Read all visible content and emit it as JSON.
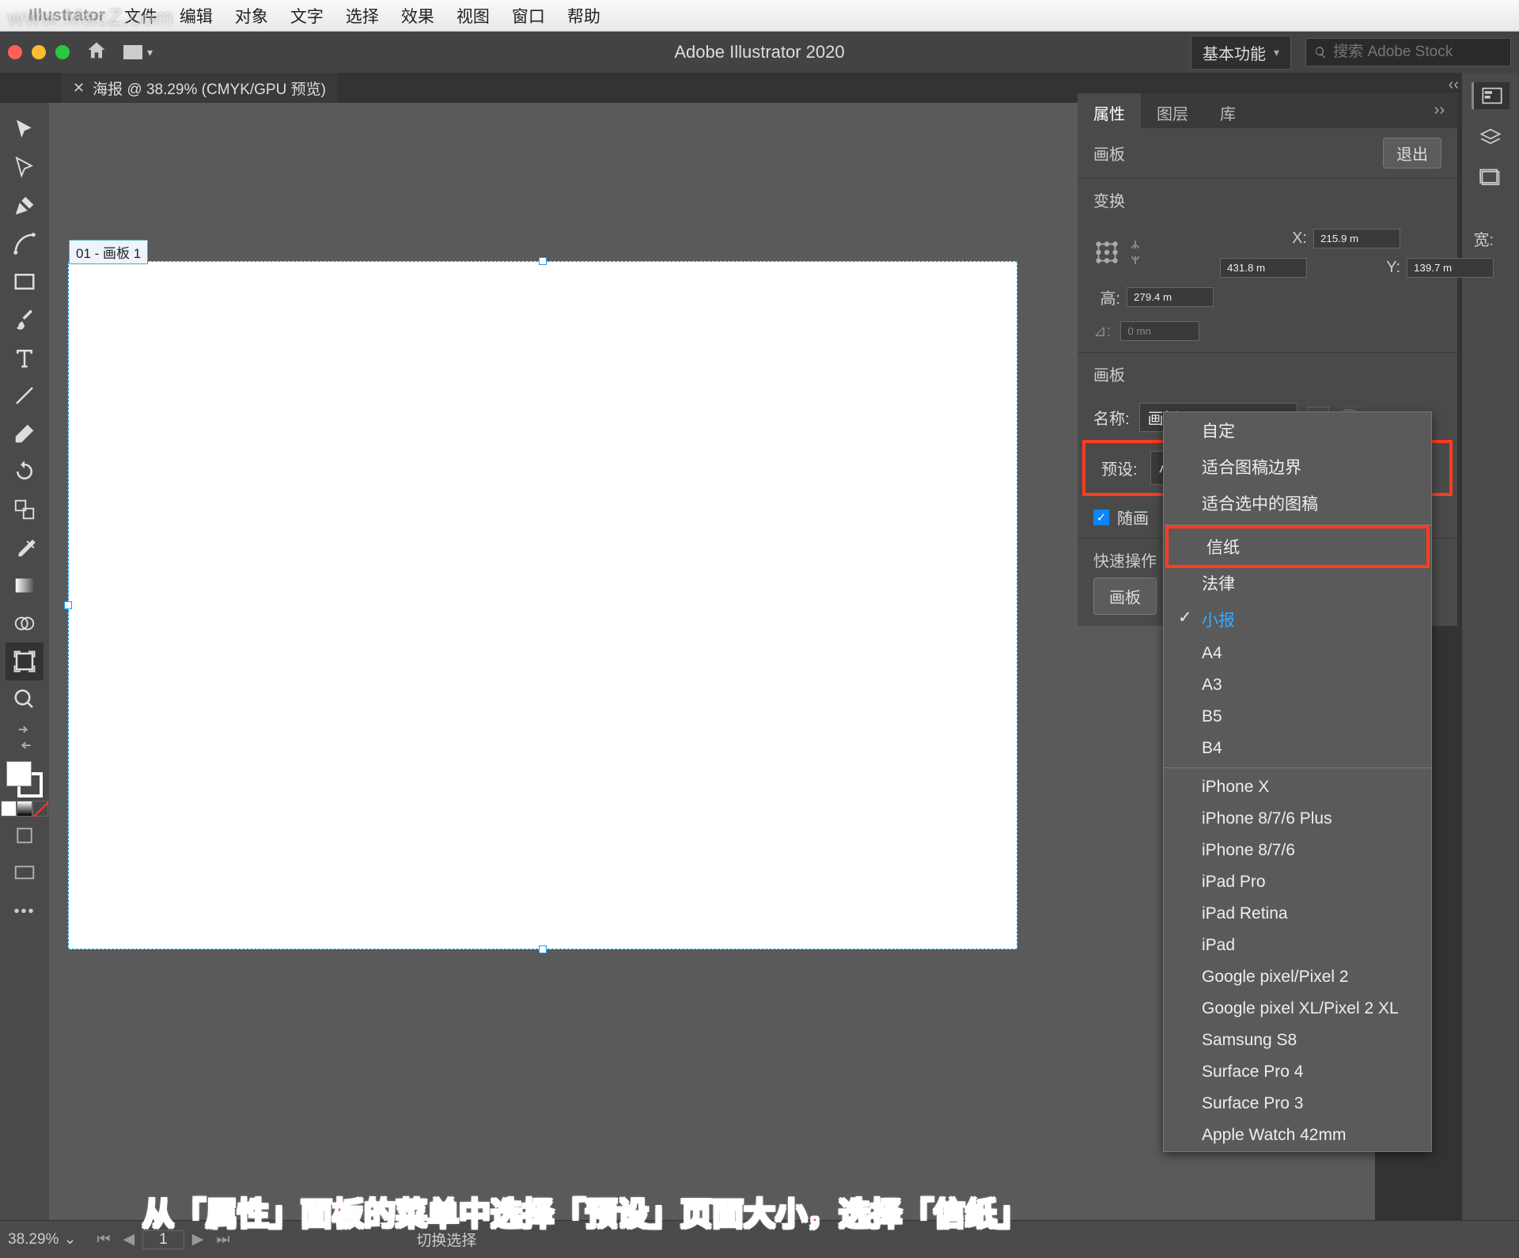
{
  "watermark": "www.MacZ.com",
  "menubar": {
    "app": "Illustrator",
    "items": [
      "文件",
      "编辑",
      "对象",
      "文字",
      "选择",
      "效果",
      "视图",
      "窗口",
      "帮助"
    ]
  },
  "titlebar": {
    "title": "Adobe Illustrator 2020",
    "workspace": "基本功能",
    "search_placeholder": "搜索 Adobe Stock"
  },
  "doc_tab": "海报 @ 38.29% (CMYK/GPU 预览)",
  "artboard_label": "01 - 画板 1",
  "panel": {
    "tabs": [
      "属性",
      "图层",
      "库"
    ],
    "section_artboard": "画板",
    "exit": "退出",
    "section_transform": "变换",
    "x_label": "X:",
    "x_val": "215.9 m",
    "w_label": "宽:",
    "w_val": "431.8 m",
    "y_label": "Y:",
    "y_val": "139.7 m",
    "h_label": "高:",
    "h_val": "279.4 m",
    "rot_label": "⊿:",
    "rot_val": "0 mn",
    "section_artboard2": "画板",
    "name_label": "名称:",
    "name_val": "画板 1",
    "preset_label": "预设:",
    "preset_val": "小报",
    "follow_label": "随画",
    "quick_label": "快速操作",
    "quick_btn": "画板"
  },
  "preset_dropdown": {
    "items": [
      "自定",
      "适合图稿边界",
      "适合选中的图稿",
      "信纸",
      "法律",
      "小报",
      "A4",
      "A3",
      "B5",
      "B4"
    ],
    "items2": [
      "iPhone X",
      "iPhone 8/7/6 Plus",
      "iPhone 8/7/6",
      "iPad Pro",
      "iPad Retina",
      "iPad",
      "Google pixel/Pixel 2",
      "Google pixel XL/Pixel 2 XL",
      "Samsung S8",
      "Surface Pro 4",
      "Surface Pro 3",
      "Apple Watch 42mm"
    ],
    "selected": "小报",
    "highlighted": "信纸"
  },
  "status": {
    "zoom": "38.29%",
    "page": "1",
    "mode": "切换选择"
  },
  "annotation": "从「属性」面板的菜单中选择「预设」页面大小，选择「信纸」"
}
